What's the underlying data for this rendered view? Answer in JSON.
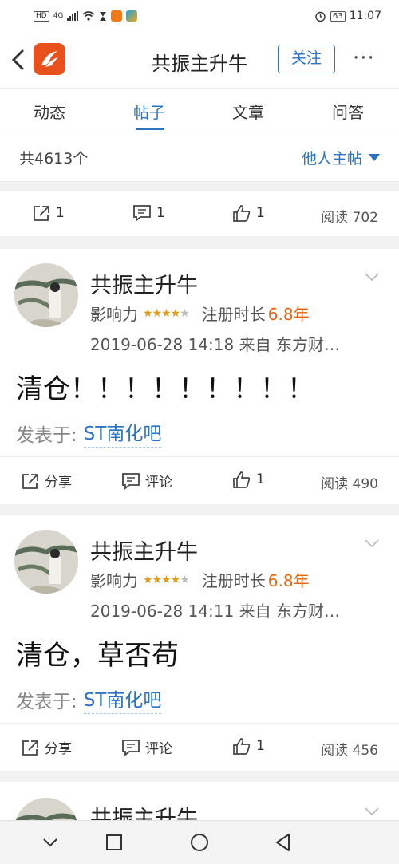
{
  "status_bar": {
    "left_badge": "HD",
    "network": "4G",
    "battery": "63",
    "time": "11:07"
  },
  "header": {
    "title": "共振主升牛",
    "follow_label": "关注",
    "more_label": "···"
  },
  "tabs": [
    {
      "label": "动态",
      "active": false
    },
    {
      "label": "帖子",
      "active": true
    },
    {
      "label": "文章",
      "active": false
    },
    {
      "label": "问答",
      "active": false
    }
  ],
  "count_bar": {
    "count": "共4613个",
    "filter": "他人主帖"
  },
  "top_actions": {
    "share": "1",
    "comment": "1",
    "like": "1",
    "read": "阅读 702"
  },
  "posts": [
    {
      "username": "共振主升牛",
      "influence_label": "影响力",
      "stars": 3.5,
      "register_label": "注册时长",
      "register_value": "6.8年",
      "meta": "2019-06-28 14:18   来自 东方财…",
      "content": "清仓！！！！！！！！！",
      "posted_in_label": "发表于:",
      "posted_in": "ST南化吧",
      "share": "分享",
      "comment": "评论",
      "like": "1",
      "read": "阅读 490"
    },
    {
      "username": "共振主升牛",
      "influence_label": "影响力",
      "stars": 3.5,
      "register_label": "注册时长",
      "register_value": "6.8年",
      "meta": "2019-06-28 14:11   来自 东方财…",
      "content": "清仓，草否苟",
      "posted_in_label": "发表于:",
      "posted_in": "ST南化吧",
      "share": "分享",
      "comment": "评论",
      "like": "1",
      "read": "阅读 456"
    }
  ],
  "partial_post": {
    "username": "共振主升牛"
  },
  "colors": {
    "accent": "#2b73c4",
    "brand": "#e8501c",
    "orange": "#e4650b"
  }
}
